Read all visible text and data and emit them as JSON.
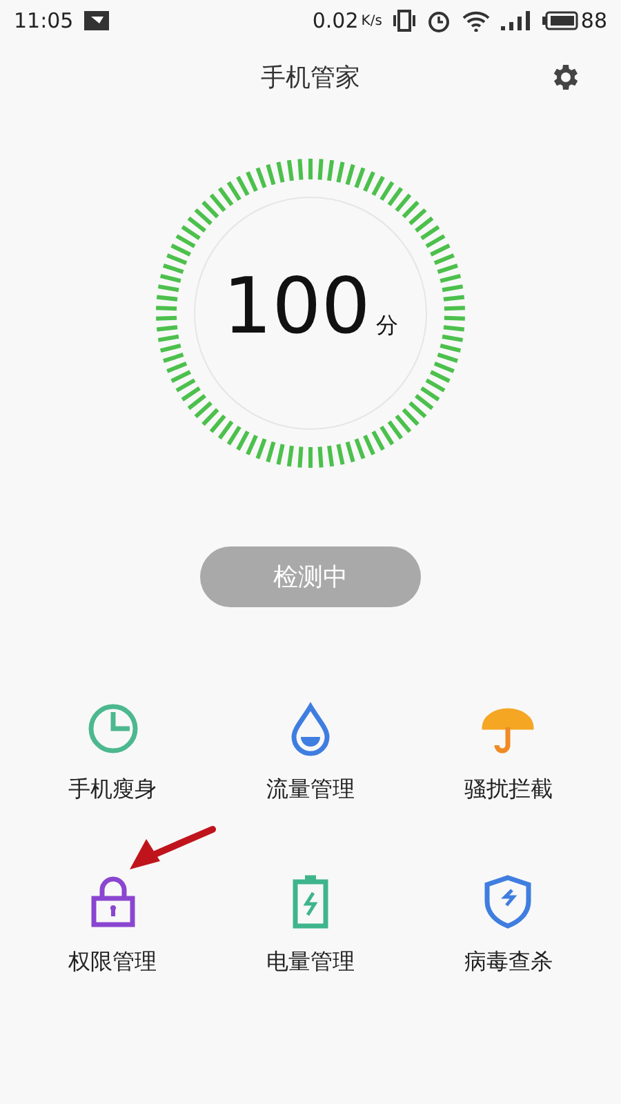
{
  "status_bar": {
    "time": "11:05",
    "speed": "0.02",
    "speed_unit": "K/s",
    "battery": "88"
  },
  "header": {
    "title": "手机管家"
  },
  "score": {
    "value": "100",
    "unit": "分"
  },
  "scan_button": {
    "label": "检测中",
    "disabled": true
  },
  "tools": [
    {
      "kind": "pie",
      "label": "手机瘦身"
    },
    {
      "kind": "drop",
      "label": "流量管理"
    },
    {
      "kind": "umbrella",
      "label": "骚扰拦截"
    },
    {
      "kind": "lock",
      "label": "权限管理"
    },
    {
      "kind": "battery",
      "label": "电量管理"
    },
    {
      "kind": "shield",
      "label": "病毒查杀"
    }
  ]
}
